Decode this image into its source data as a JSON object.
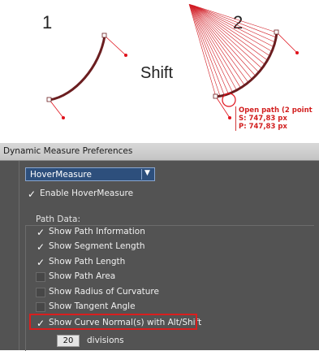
{
  "illustration": {
    "step1": "1",
    "step2": "2",
    "modifier": "Shift",
    "info_title": "Open path (2 point",
    "info_s": "S: 747,83 px",
    "info_p": "P: 747,83 px",
    "curve_color": "#6b1e20",
    "handle_color": "#e0101a"
  },
  "panel": {
    "title": "Dynamic Measure Preferences",
    "dropdown_value": "HoverMeasure",
    "enable_label": "Enable HoverMeasure",
    "enable_checked": true,
    "group_label": "Path Data:",
    "options": [
      {
        "label": "Show Path Information",
        "checked": true
      },
      {
        "label": "Show Segment Length",
        "checked": true
      },
      {
        "label": "Show Path Length",
        "checked": true
      },
      {
        "label": "Show Path Area",
        "checked": false
      },
      {
        "label": "Show Radius of Curvature",
        "checked": false
      },
      {
        "label": "Show Tangent Angle",
        "checked": false
      },
      {
        "label": "Show Curve Normal(s) with Alt/Shift",
        "checked": true
      }
    ],
    "divisions_value": "20",
    "divisions_label": "divisions",
    "highlight_color": "#d91e1e"
  }
}
